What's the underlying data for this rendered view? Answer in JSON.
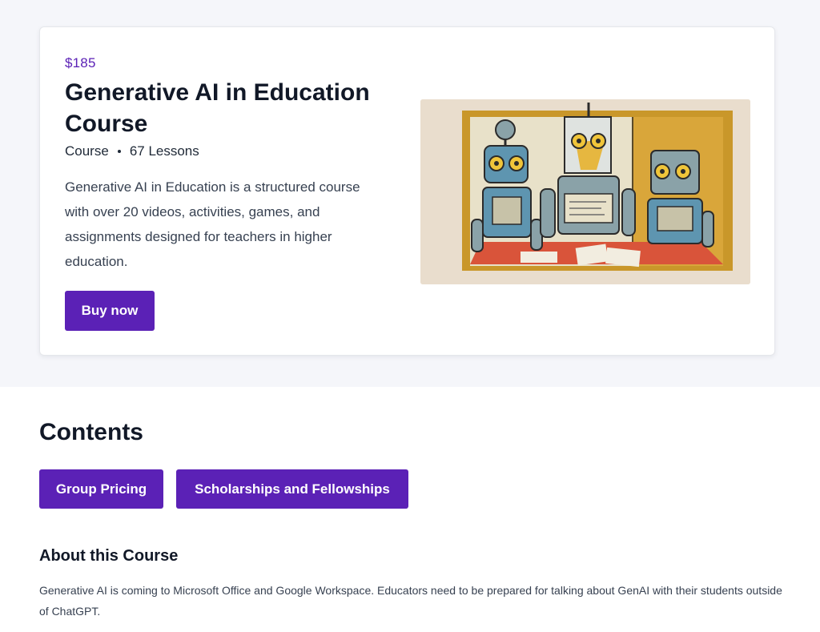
{
  "course": {
    "price": "$185",
    "title": "Generative AI in Education Course",
    "type": "Course",
    "lessons": "67 Lessons",
    "description": "Generative AI in Education is a structured course with over 20 videos, activities, games, and assignments designed for teachers in higher education.",
    "buy_label": "Buy now",
    "image_icon": "robots-illustration"
  },
  "contents": {
    "title": "Contents",
    "buttons": [
      {
        "label": "Group Pricing"
      },
      {
        "label": "Scholarships and Fellowships"
      }
    ]
  },
  "about": {
    "title": "About this Course",
    "text": "Generative AI is coming to Microsoft Office and Google Workspace. Educators need to be prepared for talking about GenAI with their students outside of ChatGPT."
  },
  "colors": {
    "accent": "#5b21b6",
    "hero_background": "#f5f6fa"
  }
}
